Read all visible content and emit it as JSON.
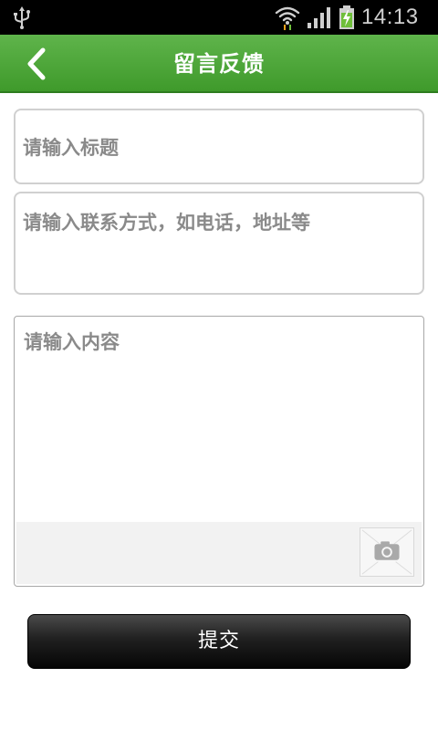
{
  "status_bar": {
    "time": "14:13",
    "icons": [
      "usb-icon",
      "wifi-icon",
      "signal-icon",
      "battery-charging-icon"
    ]
  },
  "header": {
    "title": "留言反馈",
    "back_icon": "chevron-left-icon",
    "color": "#4ea63a"
  },
  "form": {
    "title_placeholder": "请输入标题",
    "contact_placeholder": "请输入联系方式，如电话，地址等",
    "content_placeholder": "请输入内容",
    "attach_icon": "camera-icon"
  },
  "actions": {
    "submit_label": "提交"
  }
}
